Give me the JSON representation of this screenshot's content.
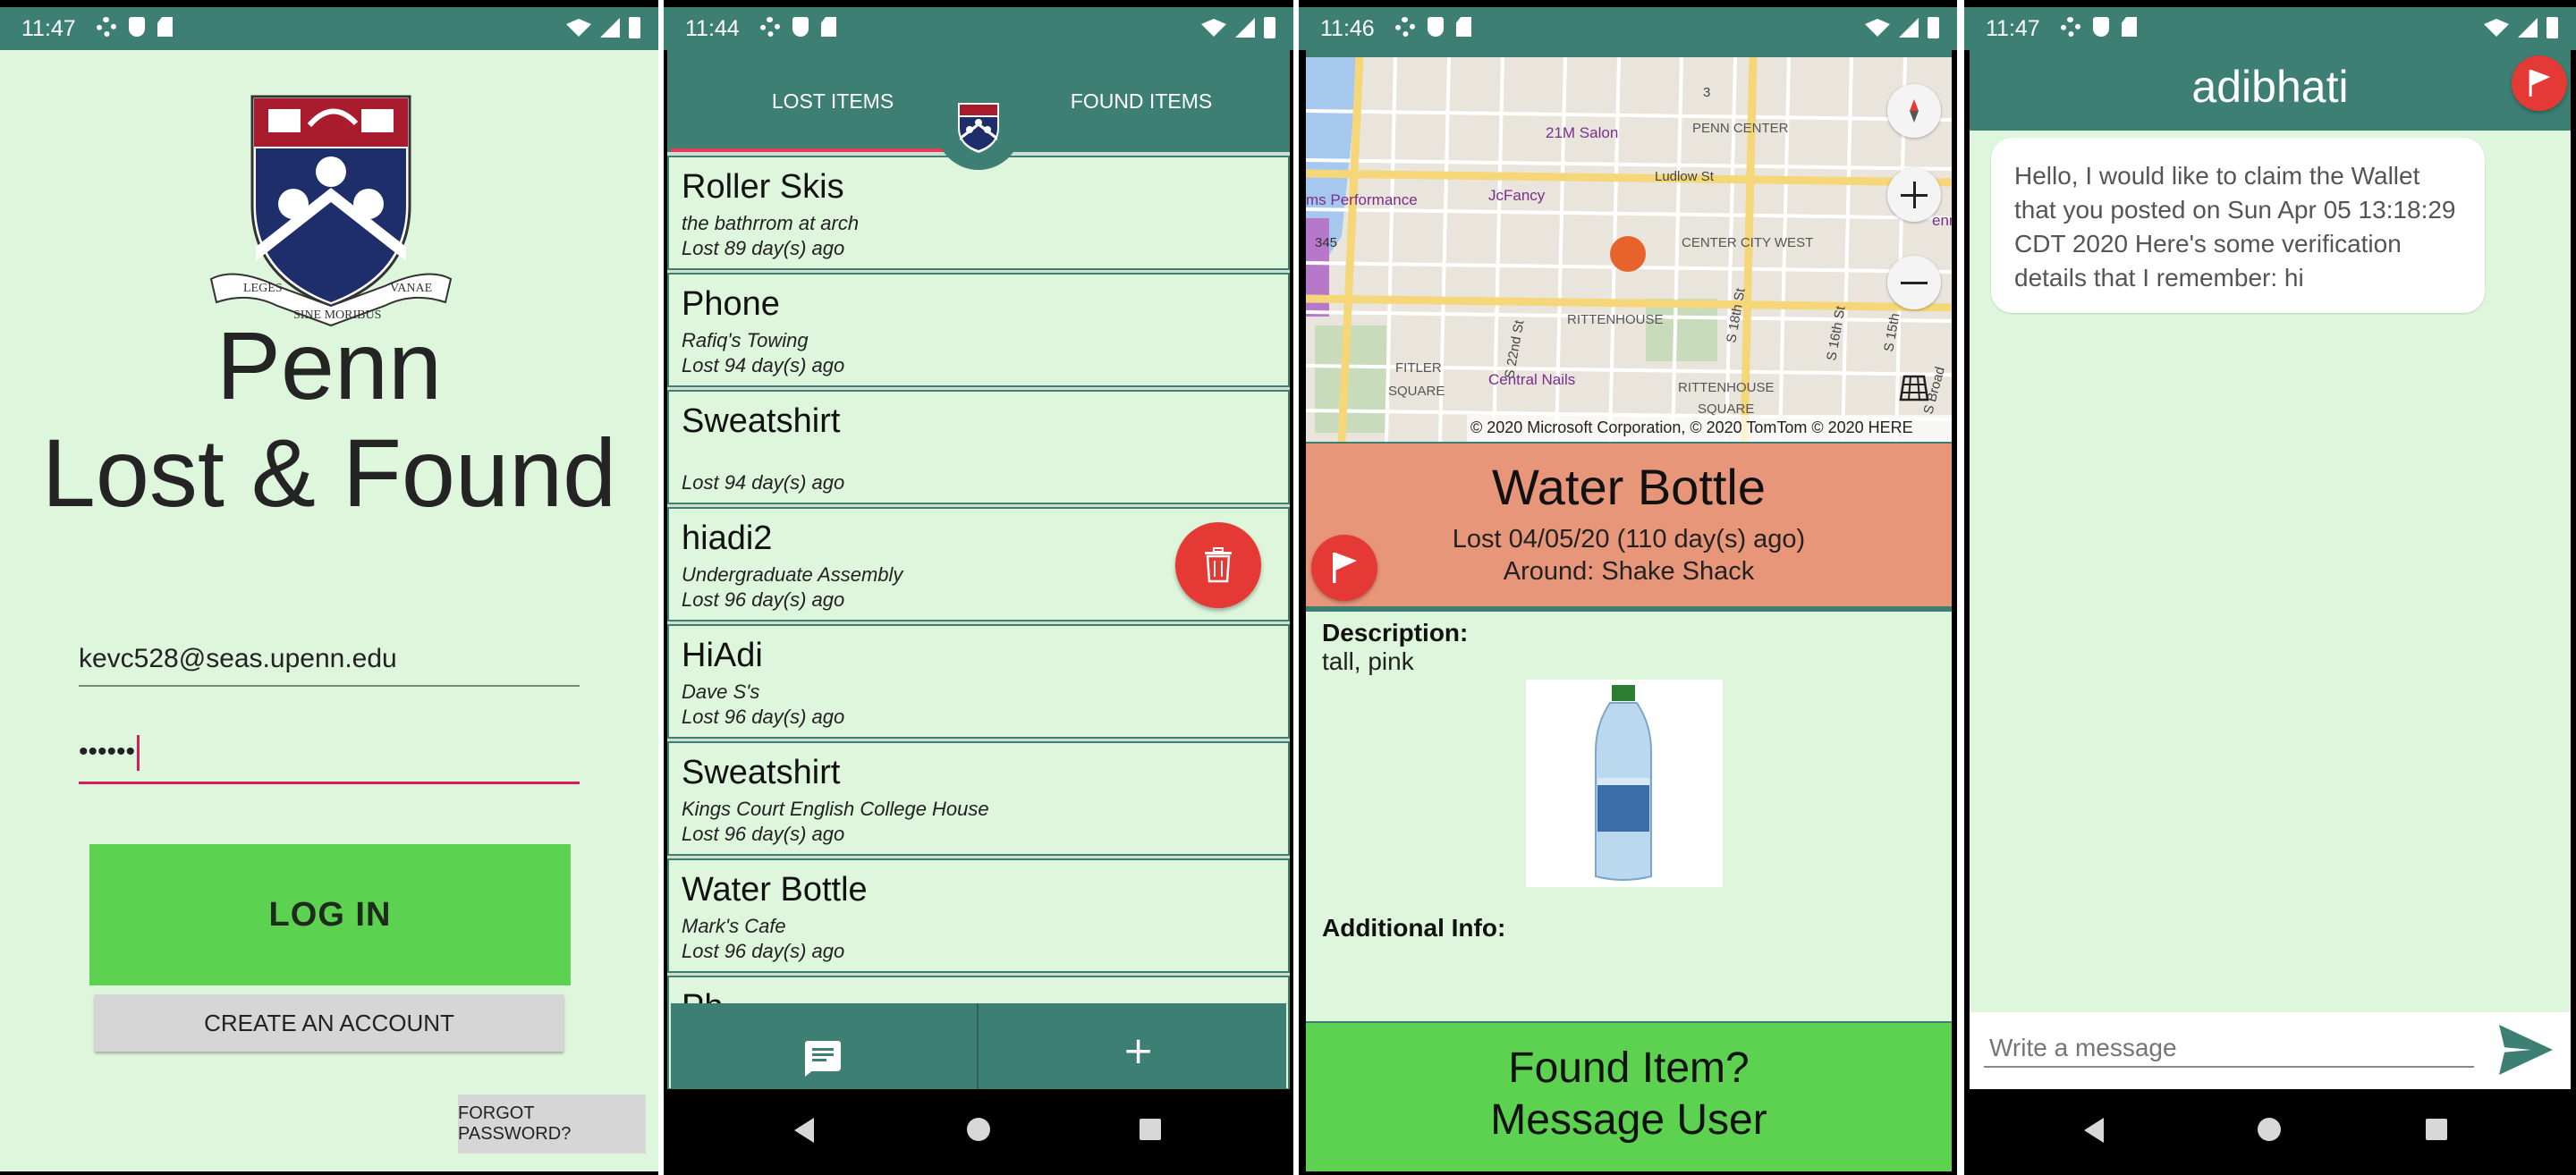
{
  "status": {
    "p1_time": "11:47",
    "p2_time": "11:44",
    "p3_time": "11:46",
    "p4_time": "11:47"
  },
  "login": {
    "title_line1": "Penn",
    "title_line2": "Lost & Found",
    "crest_motto_left": "LEGES",
    "crest_motto_right": "VANAE",
    "crest_motto_bottom": "SINE MORIBUS",
    "email": "kevc528@seas.upenn.edu",
    "password_masked": "••••••",
    "login_label": "LOG IN",
    "create_label": "CREATE AN ACCOUNT",
    "forgot_label": "FORGOT PASSWORD?"
  },
  "list": {
    "tab_lost": "LOST ITEMS",
    "tab_found": "FOUND ITEMS",
    "items": [
      {
        "name": "Roller Skis",
        "location": "the bathrrom at arch",
        "age": "Lost 89 day(s) ago"
      },
      {
        "name": "Phone",
        "location": "Rafiq's Towing",
        "age": "Lost 94 day(s) ago"
      },
      {
        "name": "Sweatshirt",
        "location": "",
        "age": "Lost 94 day(s) ago"
      },
      {
        "name": "hiadi2",
        "location": "Undergraduate Assembly",
        "age": "Lost 96 day(s) ago"
      },
      {
        "name": "HiAdi",
        "location": "Dave S's",
        "age": "Lost 96 day(s) ago"
      },
      {
        "name": "Sweatshirt",
        "location": "Kings Court English College House",
        "age": "Lost 96 day(s) ago"
      },
      {
        "name": "Water Bottle",
        "location": "Mark's Cafe",
        "age": "Lost 96 day(s) ago"
      },
      {
        "name": "Ph",
        "location": "",
        "age": ""
      }
    ],
    "plus_label": "+"
  },
  "detail": {
    "map_labels": {
      "salon": "21M Salon",
      "penn_center": "PENN CENTER",
      "ludlow": "Ludlow St",
      "performance": "ms Performance",
      "jcfancy": "JcFancy",
      "center_city": "CENTER CITY WEST",
      "num345": "345",
      "rittenhouse": "RITTENHOUSE",
      "st22": "S 22nd St",
      "st18": "S 18th St",
      "st16": "S 16th St",
      "st15": "S 15th",
      "fitler": "FITLER",
      "square": "SQUARE",
      "central_nails": "Central Nails",
      "rittenhouse2": "RITTENHOUSE",
      "square2": "SQUARE",
      "broad": "S Broad",
      "num3": "3",
      "enn": "enn",
      "attribution": "© 2020 Microsoft Corporation, © 2020 TomTom © 2020 HERE"
    },
    "item_name": "Water Bottle",
    "lost_line": "Lost 04/05/20 (110 day(s) ago)",
    "around_line": "Around: Shake Shack",
    "desc_label": "Description:",
    "desc_value": "tall, pink",
    "addl_label": "Additional Info:",
    "found_line1": "Found Item?",
    "found_line2": "Message User"
  },
  "chat": {
    "username": "adibhati",
    "message": "Hello, I would like to claim the Wallet that you posted on Sun Apr 05 13:18:29 CDT 2020 Here's some verification details that I remember: hi",
    "input_placeholder": "Write a message"
  },
  "colors": {
    "teal": "#3d7f72",
    "mint": "#ddf6dc",
    "green": "#5dd150",
    "red": "#e53935",
    "salmon": "#e8967a"
  }
}
